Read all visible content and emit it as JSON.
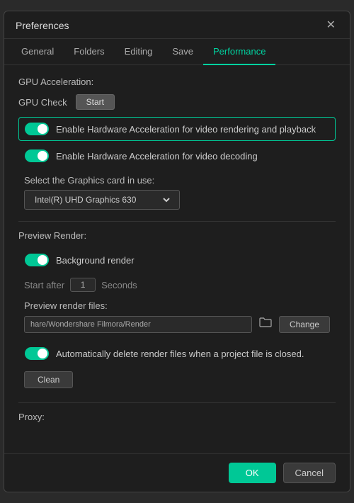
{
  "dialog": {
    "title": "Preferences",
    "close_label": "✕"
  },
  "tabs": [
    {
      "id": "general",
      "label": "General",
      "active": false
    },
    {
      "id": "folders",
      "label": "Folders",
      "active": false
    },
    {
      "id": "editing",
      "label": "Editing",
      "active": false
    },
    {
      "id": "save",
      "label": "Save",
      "active": false
    },
    {
      "id": "performance",
      "label": "Performance",
      "active": true
    }
  ],
  "gpu_acceleration": {
    "section_label": "GPU Acceleration:",
    "gpu_check_label": "GPU Check",
    "start_button": "Start",
    "toggle1": {
      "label": "Enable Hardware Acceleration for video rendering and playback",
      "state": "on",
      "highlighted": true
    },
    "toggle2": {
      "label": "Enable Hardware Acceleration for video decoding",
      "state": "on",
      "highlighted": false
    },
    "select_label": "Select the Graphics card in use:",
    "graphics_card": "Intel(R) UHD Graphics 630",
    "graphics_card_options": [
      "Intel(R) UHD Graphics 630"
    ]
  },
  "preview_render": {
    "section_label": "Preview Render:",
    "background_render_toggle": {
      "label": "Background render",
      "state": "on"
    },
    "start_after_label": "Start after",
    "start_after_value": "1",
    "seconds_label": "Seconds",
    "files_label": "Preview render files:",
    "path_value": "hare/Wondershare Filmora/Render",
    "change_button": "Change",
    "auto_delete_toggle": {
      "label": "Automatically delete render files when a project file is closed.",
      "state": "on"
    },
    "clean_button": "Clean"
  },
  "proxy": {
    "label": "Proxy:"
  },
  "footer": {
    "ok_label": "OK",
    "cancel_label": "Cancel"
  }
}
